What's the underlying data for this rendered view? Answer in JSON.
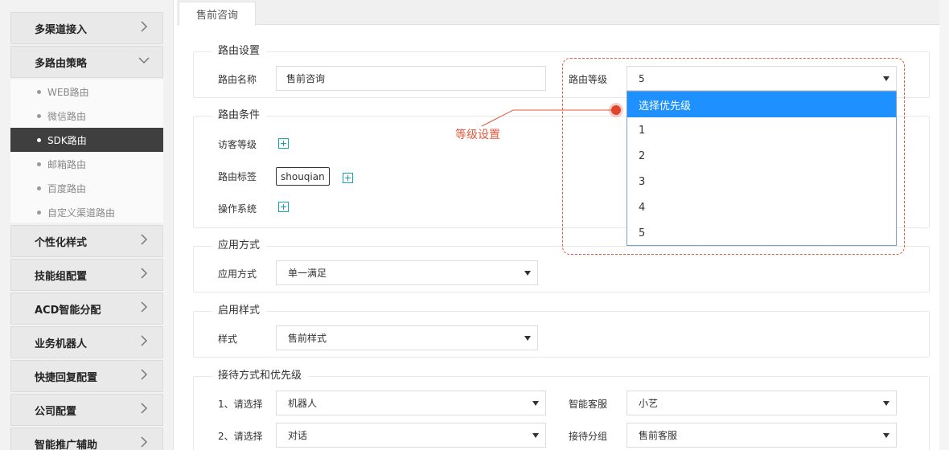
{
  "sidebar": {
    "menu": [
      {
        "label": "多渠道接入"
      },
      {
        "label": "多路由策略"
      },
      {
        "label": "个性化样式"
      },
      {
        "label": "技能组配置"
      },
      {
        "label": "ACD智能分配"
      },
      {
        "label": "业务机器人"
      },
      {
        "label": "快捷回复配置"
      },
      {
        "label": "公司配置"
      },
      {
        "label": "智能推广辅助"
      }
    ],
    "submenu": [
      {
        "label": "WEB路由"
      },
      {
        "label": "微信路由"
      },
      {
        "label": "SDK路由"
      },
      {
        "label": "邮箱路由"
      },
      {
        "label": "百度路由"
      },
      {
        "label": "自定义渠道路由"
      }
    ]
  },
  "tabs": [
    {
      "label": "售前咨询"
    }
  ],
  "route_settings": {
    "legend": "路由设置",
    "name_label": "路由名称",
    "name_value": "售前咨询",
    "level_label": "路由等级",
    "level_value": "5"
  },
  "route_conditions": {
    "legend": "路由条件",
    "visitor_level_label": "访客等级",
    "route_tag_label": "路由标签",
    "route_tag_value": "shouqian",
    "os_label": "操作系统"
  },
  "apply_mode": {
    "legend": "应用方式",
    "label": "应用方式",
    "value": "单一满足"
  },
  "style": {
    "legend": "启用样式",
    "label": "样式",
    "value": "售前样式"
  },
  "reception": {
    "legend": "接待方式和优先级",
    "rows": [
      {
        "label": "1、请选择",
        "value": "机器人",
        "right_label": "智能客服",
        "right_value": "小艺"
      },
      {
        "label": "2、请选择",
        "value": "对话",
        "right_label": "接待分组",
        "right_value": "售前客服"
      }
    ]
  },
  "level_dropdown": {
    "options": [
      "选择优先级",
      "1",
      "2",
      "3",
      "4",
      "5"
    ],
    "highlighted": "选择优先级"
  },
  "annotation": {
    "text": "等级设置",
    "color": "#e05a3e"
  },
  "colors": {
    "accent": "#1e90ff",
    "active_sidebar": "#3f3f3f",
    "plus_icon": "#16a3b8"
  }
}
